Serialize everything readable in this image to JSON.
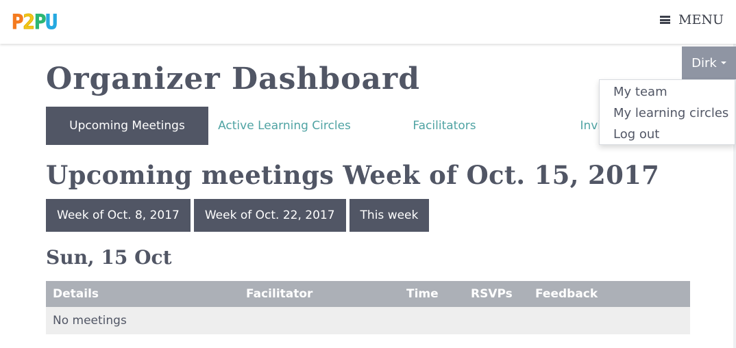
{
  "header": {
    "logo": [
      "P",
      "2",
      "P",
      "U"
    ],
    "menu_label": "MENU"
  },
  "user_menu": {
    "name": "Dirk",
    "items": [
      "My team",
      "My learning circles",
      "Log out"
    ]
  },
  "page": {
    "title": "Organizer Dashboard"
  },
  "tabs": [
    {
      "label": "Upcoming Meetings",
      "active": true
    },
    {
      "label": "Active Learning Circles",
      "active": false
    },
    {
      "label": "Facilitators",
      "active": false
    },
    {
      "label": "Invitations",
      "active": false
    }
  ],
  "meetings": {
    "heading": "Upcoming meetings Week of Oct. 15, 2017",
    "buttons": [
      "Week of Oct. 8, 2017",
      "Week of Oct. 22, 2017",
      "This week"
    ],
    "day": "Sun, 15 Oct",
    "columns": [
      "Details",
      "Facilitator",
      "Time",
      "RSVPs",
      "Feedback"
    ],
    "empty_text": "No meetings"
  },
  "colors": {
    "primary": "#515665",
    "accent": "#4fa3a3",
    "user_button": "#8f95a3",
    "table_header": "#acb0b7"
  }
}
